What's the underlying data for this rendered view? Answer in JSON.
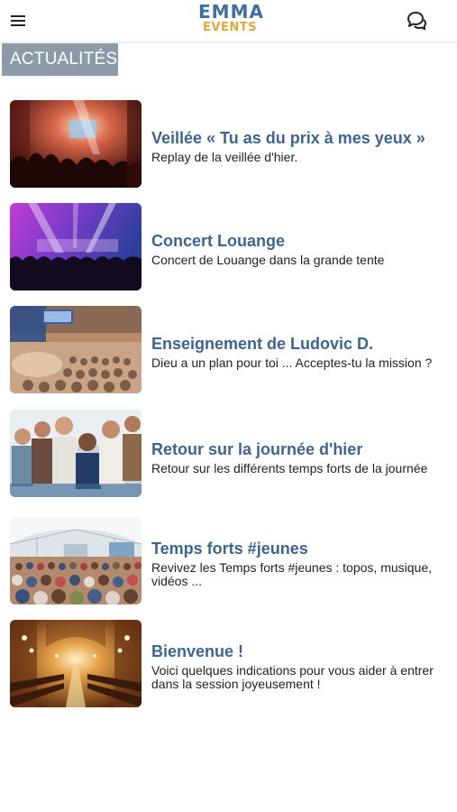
{
  "header": {
    "logo_line1": "EMMA",
    "logo_line2": "EVENTS",
    "menu_icon": "hamburger-menu-icon",
    "chat_icon": "chat-bubbles-icon"
  },
  "section": {
    "title": "ACTUALITÉS"
  },
  "colors": {
    "brand_blue": "#3f6ea0",
    "brand_gold": "#e0a838",
    "title_blue": "#3c6592",
    "section_tab_gray": "#8c9ba7"
  },
  "news": [
    {
      "title": "Veillée « Tu as du prix à mes yeux »",
      "description": "Replay de la veillée d'hier."
    },
    {
      "title": "Concert Louange",
      "description": "Concert de Louange dans la grande tente"
    },
    {
      "title": "Enseignement de Ludovic D.",
      "description": "Dieu a un plan pour toi ... Acceptes-tu la mission ?"
    },
    {
      "title": "Retour sur la journée d'hier",
      "description": "Retour sur les différents temps forts de la journée"
    },
    {
      "title": "Temps forts #jeunes",
      "description": "Revivez les Temps forts #jeunes : topos, musique, vidéos ..."
    },
    {
      "title": "Bienvenue !",
      "description": "Voici quelques indications pour vous aider à entrer dans la session joyeusement !"
    }
  ]
}
